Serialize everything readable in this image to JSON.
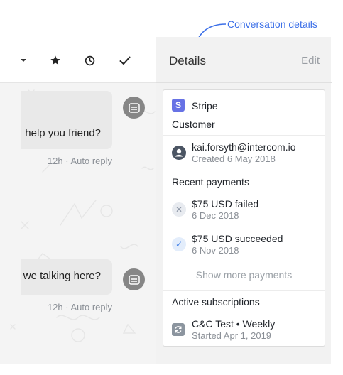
{
  "annotation": {
    "label": "Conversation details"
  },
  "conversation": {
    "toolbar": {
      "icons": [
        "chevron-down-icon",
        "star-icon",
        "clock-icon",
        "check-icon"
      ]
    },
    "messages": [
      {
        "text": "I help you friend?",
        "meta": "12h · Auto reply"
      },
      {
        "text": "e we talking here?",
        "meta": "12h · Auto reply"
      }
    ]
  },
  "details": {
    "title": "Details",
    "edit_label": "Edit",
    "app_name": "Stripe",
    "customer_heading": "Customer",
    "customer": {
      "email": "kai.forsyth@intercom.io",
      "created": "Created 6 May 2018"
    },
    "payments_heading": "Recent payments",
    "payments": [
      {
        "title": "$75 USD failed",
        "date": "6 Dec 2018",
        "status": "failed"
      },
      {
        "title": "$75 USD succeeded",
        "date": "6 Nov 2018",
        "status": "succeeded"
      }
    ],
    "show_more_label": "Show more payments",
    "subscriptions_heading": "Active subscriptions",
    "subscription": {
      "name": "C&C Test • Weekly",
      "started": "Started Apr 1, 2019"
    }
  },
  "colors": {
    "accent": "#3b6fe8",
    "stripe": "#6772e5",
    "success": "#4a86e8"
  }
}
